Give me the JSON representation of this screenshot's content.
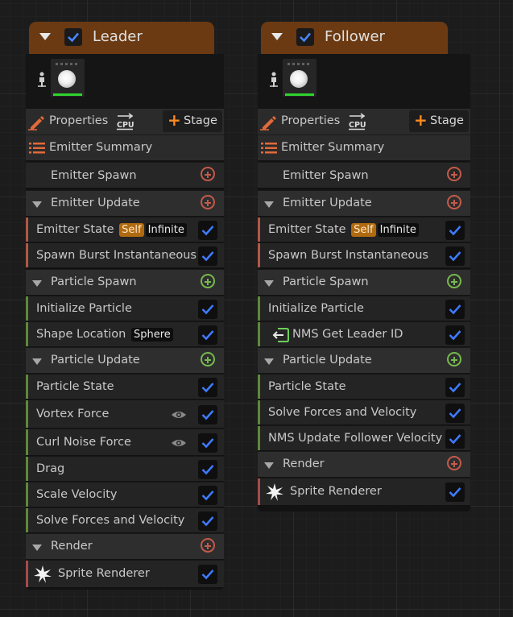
{
  "colors": {
    "emitter_stripe": "#b25745",
    "particle_stripe": "#5d8a36",
    "render_stripe": "#a94a4a",
    "checkbox_blue": "#3f7bff"
  },
  "leader": {
    "title": "Leader",
    "properties_label": "Properties",
    "stage_label": "Stage",
    "summary_label": "Emitter Summary",
    "emitter_spawn": "Emitter Spawn",
    "emitter_update": "Emitter Update",
    "emitter_modules": [
      {
        "label": "Emitter State",
        "tag_self": "Self",
        "tag_infinite": "Infinite"
      },
      {
        "label": "Spawn Burst Instantaneous"
      }
    ],
    "particle_spawn": "Particle Spawn",
    "spawn_modules": [
      {
        "label": "Initialize Particle"
      },
      {
        "label": "Shape Location",
        "tag": "Sphere"
      }
    ],
    "particle_update": "Particle Update",
    "update_modules": [
      {
        "label": "Particle State"
      },
      {
        "label": "Vortex Force"
      },
      {
        "label": "Curl Noise Force"
      },
      {
        "label": "Drag"
      },
      {
        "label": "Scale Velocity"
      },
      {
        "label": "Solve Forces and Velocity"
      }
    ],
    "render": "Render",
    "renderer": "Sprite Renderer"
  },
  "follower": {
    "title": "Follower",
    "properties_label": "Properties",
    "stage_label": "Stage",
    "summary_label": "Emitter Summary",
    "emitter_spawn": "Emitter Spawn",
    "emitter_update": "Emitter Update",
    "emitter_modules": [
      {
        "label": "Emitter State",
        "tag_self": "Self",
        "tag_infinite": "Infinite"
      },
      {
        "label": "Spawn Burst Instantaneous"
      }
    ],
    "particle_spawn": "Particle Spawn",
    "spawn_modules": [
      {
        "label": "Initialize Particle"
      },
      {
        "label": "NMS Get Leader ID"
      }
    ],
    "particle_update": "Particle Update",
    "update_modules": [
      {
        "label": "Particle State"
      },
      {
        "label": "Solve Forces and Velocity"
      },
      {
        "label": "NMS Update Follower Velocity"
      }
    ],
    "render": "Render",
    "renderer": "Sprite Renderer"
  }
}
